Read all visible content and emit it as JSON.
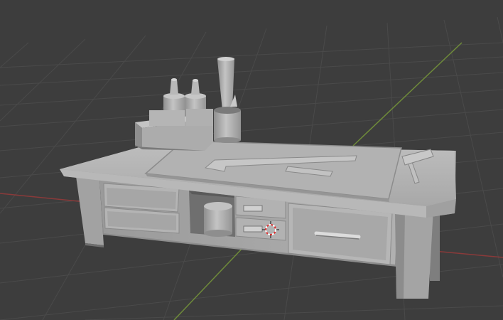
{
  "viewport": {
    "background": "#3d3d3d",
    "grid_color": "#4a4a4a",
    "x_axis_color": "#8a3a3a",
    "y_axis_color": "#6e8a3a",
    "shading": "solid",
    "model_color": "#a9a9a9"
  },
  "scene": {
    "model": "workbench-desk",
    "parts": [
      "desktop",
      "left-drawers",
      "open-shelf",
      "small-drawers",
      "right-drawer",
      "legs",
      "cutting-mat",
      "ruler",
      "pencil",
      "mallet",
      "glue-box",
      "glue-bottles",
      "pencil-cup",
      "paper-roll",
      "canister"
    ],
    "cursor": "3d-cursor-icon"
  }
}
